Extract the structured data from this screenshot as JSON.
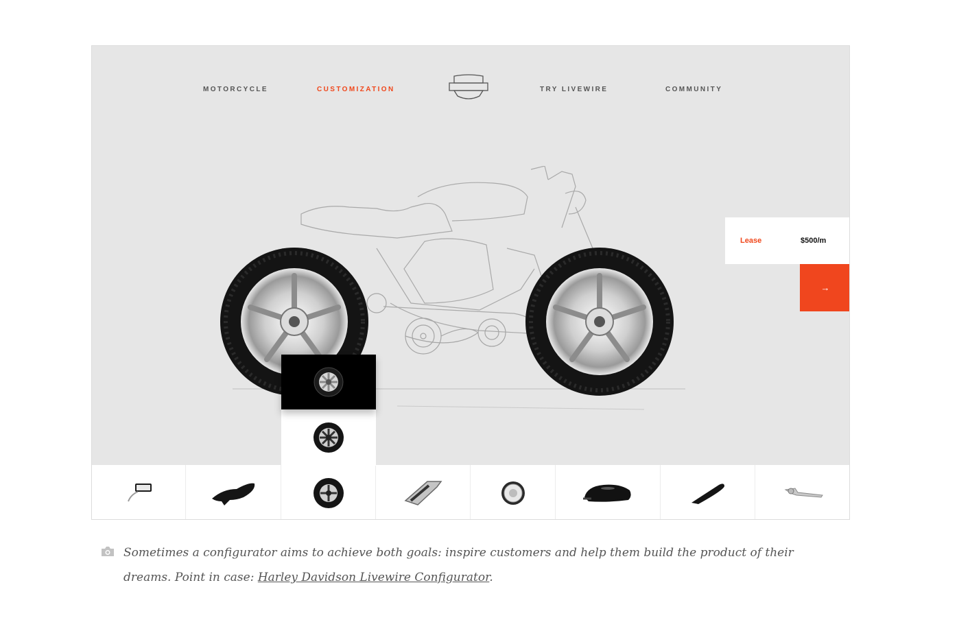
{
  "nav": {
    "items": [
      {
        "label": "MOTORCYCLE",
        "active": false
      },
      {
        "label": "CUSTOMIZATION",
        "active": true
      },
      {
        "label": "TRY LIVEWIRE",
        "active": false
      },
      {
        "label": "COMMUNITY",
        "active": false
      }
    ],
    "logo_icon": "harley-davidson-shield-icon"
  },
  "lease": {
    "label": "Lease",
    "price": "$500/m",
    "next_icon": "arrow-right-icon"
  },
  "wheel_options": [
    {
      "icon": "wheel-chrome-icon",
      "selected": true
    },
    {
      "icon": "wheel-black-icon",
      "selected": false
    }
  ],
  "parts": [
    {
      "icon": "mirror-icon"
    },
    {
      "icon": "seat-icon"
    },
    {
      "icon": "wheel-icon",
      "active": true
    },
    {
      "icon": "footpeg-icon"
    },
    {
      "icon": "headlight-icon"
    },
    {
      "icon": "fuel-tank-icon"
    },
    {
      "icon": "tail-section-icon"
    },
    {
      "icon": "brake-lever-icon"
    }
  ],
  "caption": {
    "text": "Sometimes a configurator aims to achieve both goals: inspire customers and help them build the product of their dreams. Point in case: ",
    "link_text": "Harley Davidson Livewire Configurator",
    "suffix": ".",
    "icon": "camera-icon"
  },
  "colors": {
    "accent": "#f0471b",
    "canvas": "#e6e6e6"
  }
}
